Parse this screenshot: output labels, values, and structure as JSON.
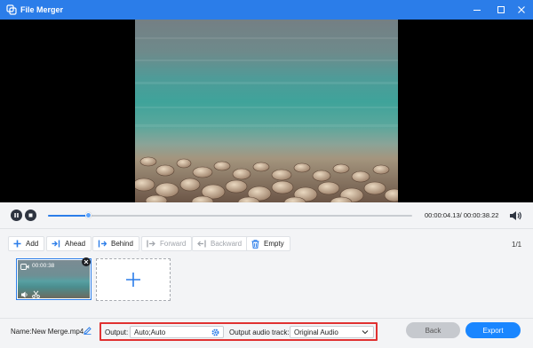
{
  "window": {
    "title": "File Merger",
    "app_icon": "merge-icon",
    "controls": [
      "minimize-icon",
      "restore-icon",
      "close-icon"
    ]
  },
  "player": {
    "play_state": "playing",
    "controls": [
      "pause-icon",
      "stop-icon"
    ],
    "current_time": "00:00:04.13",
    "total_time": "00:00:38.22",
    "time_separator": "/",
    "progress": 0.11,
    "volume_icon": "speaker-icon"
  },
  "toolbar": {
    "add": "Add",
    "ahead": "Ahead",
    "behind": "Behind",
    "forward": "Forward",
    "backward": "Backward",
    "empty": "Empty",
    "page": "1/1"
  },
  "clips": [
    {
      "time": "00:00:38",
      "selected": true
    }
  ],
  "add_clip_icon": "plus-icon",
  "bottom": {
    "name_label": "Name:New Merge.mp4",
    "output_label": "Output:",
    "output_value": "Auto;Auto",
    "audio_label": "Output audio track:",
    "audio_value": "Original Audio",
    "back": "Back",
    "export": "Export"
  },
  "colors": {
    "titlebar": "#2b7de9",
    "accent": "#1a86ff",
    "highlight": "#e03131"
  }
}
